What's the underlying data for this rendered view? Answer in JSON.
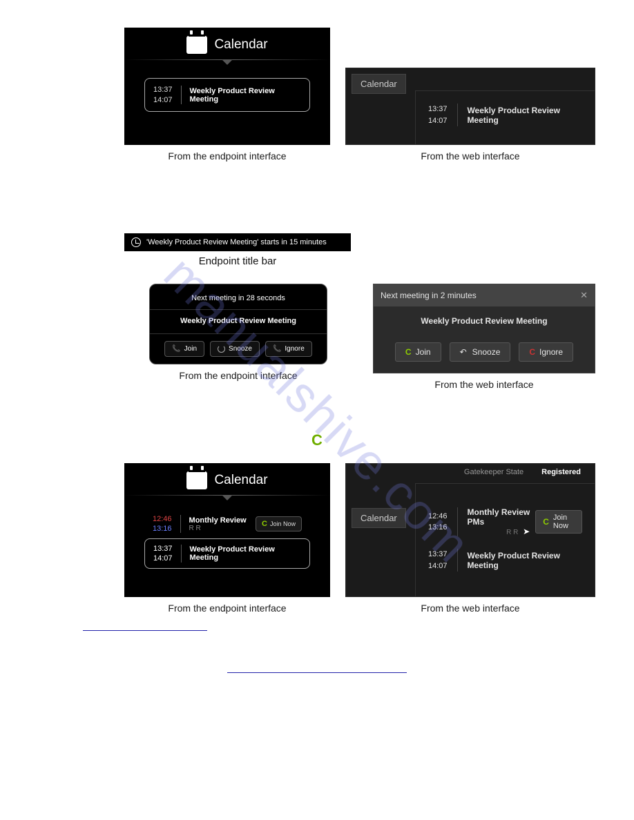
{
  "watermark": "manualshive.com",
  "fig1": {
    "ep": {
      "cal_title": "Calendar",
      "start": "13:37",
      "end": "14:07",
      "meeting": "Weekly Product Review Meeting",
      "caption": "From the endpoint interface"
    },
    "web": {
      "tab": "Calendar",
      "start": "13:37",
      "end": "14:07",
      "meeting": "Weekly Product Review Meeting",
      "caption": "From the web interface"
    }
  },
  "fig2": {
    "titlebar": "'Weekly Product Review Meeting' starts in 15 minutes",
    "titlebar_caption": "Endpoint title bar",
    "ep": {
      "heading": "Next meeting in 28 seconds",
      "meeting": "Weekly Product Review Meeting",
      "join": "Join",
      "snooze": "Snooze",
      "ignore": "Ignore",
      "caption": "From the endpoint interface"
    },
    "web": {
      "heading": "Next meeting in 2 minutes",
      "meeting": "Weekly Product Review Meeting",
      "join": "Join",
      "snooze": "Snooze",
      "ignore": "Ignore",
      "caption": "From the web interface"
    }
  },
  "green_phone": "C",
  "fig3": {
    "ep": {
      "cal_title": "Calendar",
      "item1": {
        "start": "12:46",
        "end": "13:16",
        "name": "Monthly Review",
        "sub": "R R",
        "join": "Join Now"
      },
      "item2": {
        "start": "13:37",
        "end": "14:07",
        "name": "Weekly Product Review Meeting"
      },
      "caption": "From the endpoint interface"
    },
    "web": {
      "gatekeeper_label": "Gatekeeper State",
      "gatekeeper_value": "Registered",
      "tab": "Calendar",
      "item1": {
        "start": "12:46",
        "end": "13:16",
        "name": "Monthly Review PMs",
        "sub": "R R",
        "join": "Join Now"
      },
      "item2": {
        "start": "13:37",
        "end": "14:07",
        "name": "Weekly Product Review Meeting"
      },
      "caption": "From the web interface"
    }
  }
}
